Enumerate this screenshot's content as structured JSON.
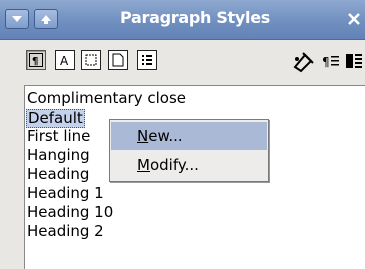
{
  "window": {
    "title": "Paragraph Styles",
    "close_glyph": "✕",
    "menu_glyph": "▾",
    "up_glyph": "▴"
  },
  "toolbar": {
    "icons": [
      "paragraph-styles-icon",
      "character-styles-icon",
      "frame-styles-icon",
      "page-styles-icon",
      "list-styles-icon",
      "fill-format-icon",
      "new-style-from-selection-icon",
      "update-style-icon"
    ]
  },
  "styles_list": {
    "items": [
      "Complimentary close",
      "Default",
      "First line",
      "Hanging",
      "Heading",
      "Heading 1",
      "Heading 10",
      "Heading 2"
    ],
    "selected": "Default"
  },
  "context_menu": {
    "new_label_ul": "N",
    "new_label_rest": "ew...",
    "modify_label_ul": "M",
    "modify_label_rest": "odify..."
  }
}
